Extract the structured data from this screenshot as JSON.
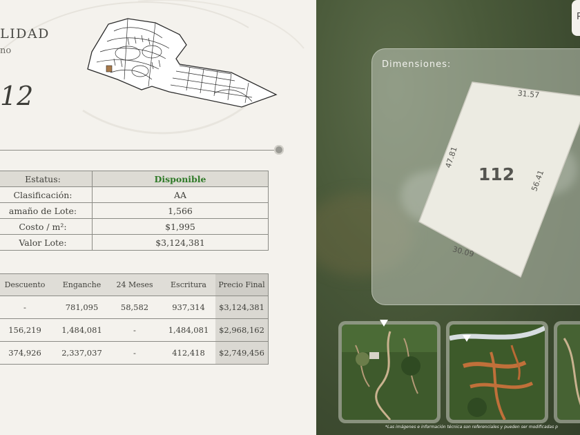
{
  "header": {
    "title_fragment": "LIDAD",
    "subtitle_fragment": "no",
    "lot_number_large": "12"
  },
  "info_table": {
    "rows": [
      {
        "label": "Estatus:",
        "value": "Disponible"
      },
      {
        "label": "Clasificación:",
        "value": "AA"
      },
      {
        "label": "amaño de Lote:",
        "value": "1,566"
      },
      {
        "label": "Costo / m²:",
        "value": "$1,995"
      },
      {
        "label": "Valor Lote:",
        "value": "$3,124,381"
      }
    ]
  },
  "payment_table": {
    "headers": [
      "Descuento",
      "Enganche",
      "24 Meses",
      "Escritura",
      "Precio Final"
    ],
    "rows": [
      [
        "-",
        "781,095",
        "58,582",
        "937,314",
        "$3,124,381"
      ],
      [
        "156,219",
        "1,484,081",
        "-",
        "1,484,081",
        "$2,968,162"
      ],
      [
        "374,926",
        "2,337,037",
        "-",
        "412,418",
        "$2,749,456"
      ]
    ]
  },
  "dimensions": {
    "label": "Dimensiones:",
    "lot_number": "112",
    "sides": {
      "top": "31.57",
      "left": "47.81",
      "right": "56.41",
      "bottom": "30.09"
    }
  },
  "top_right_fragment": "P",
  "footnote": "*Las imágenes e información técnica son referenciales y pueden ser modificadas p",
  "colors": {
    "status_available": "#2f7a28",
    "panel_bg": "#f4f2ed",
    "highlight_lot": "#a9794a"
  }
}
